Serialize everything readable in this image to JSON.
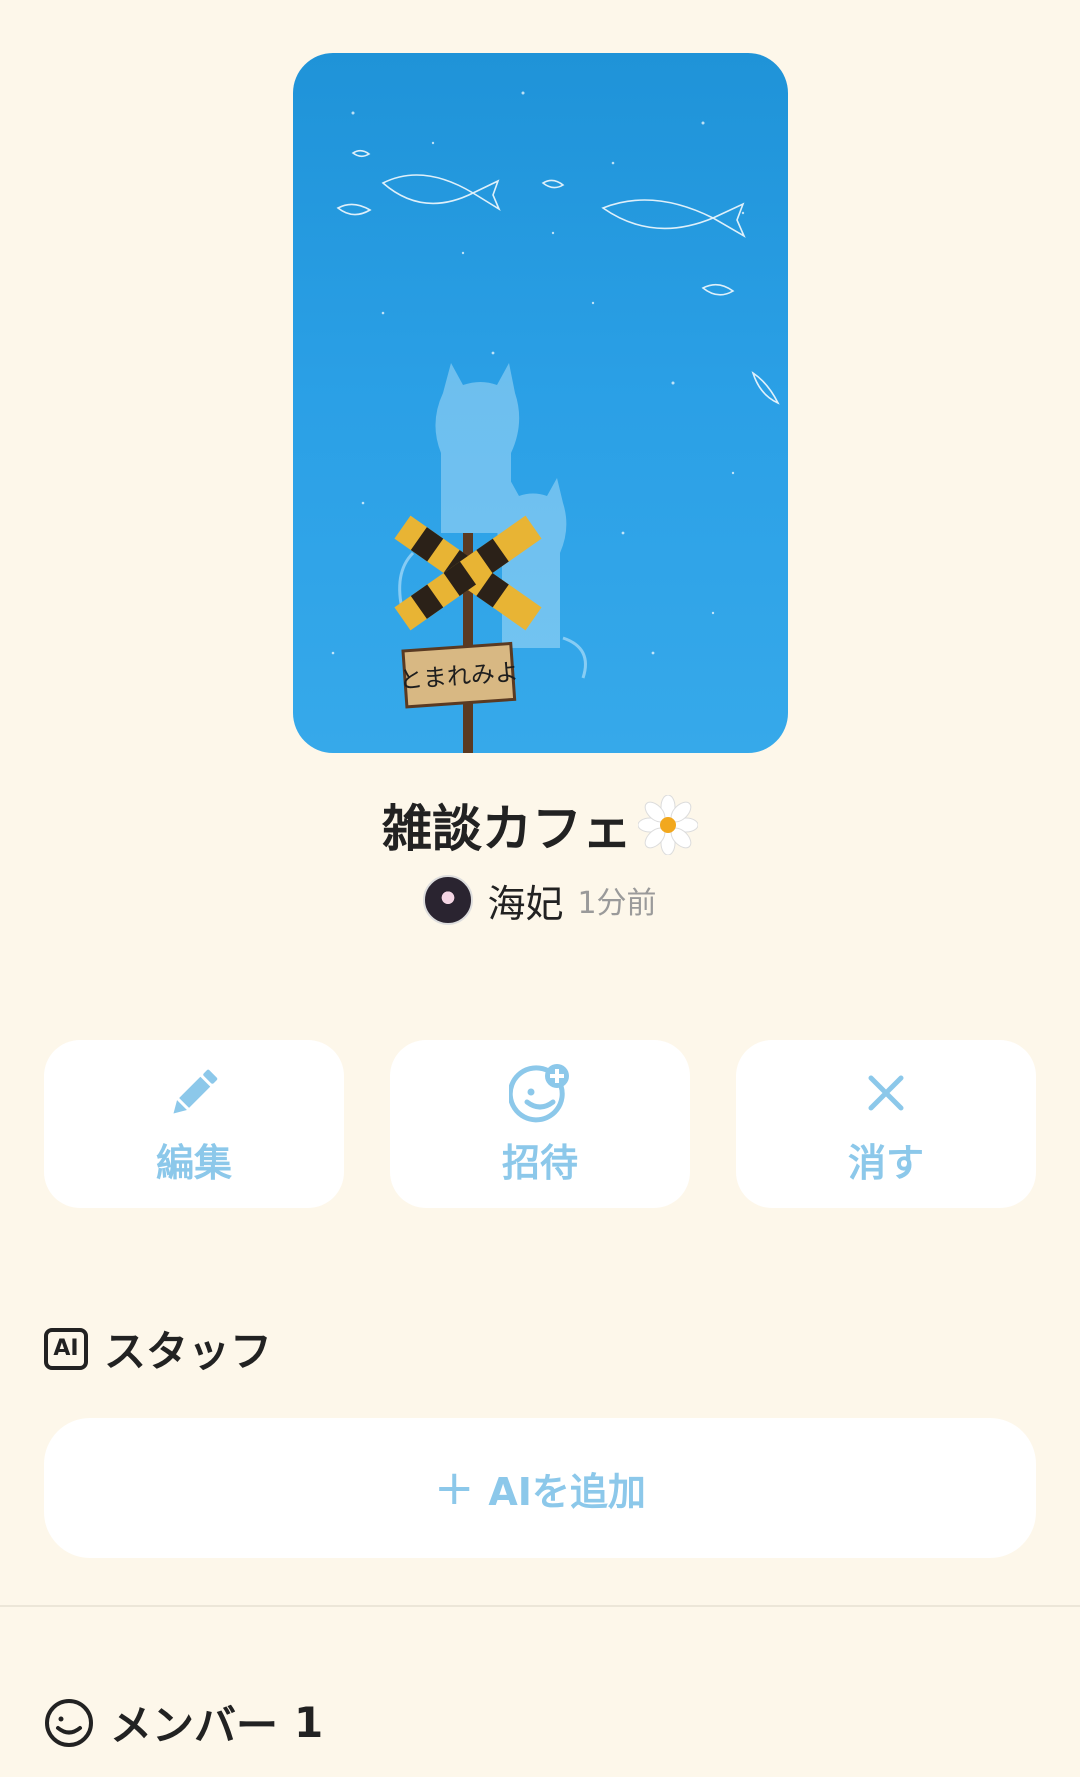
{
  "room": {
    "title": "雑談カフェ",
    "cover_sign_text": "とまれみよ",
    "author": {
      "name": "海妃",
      "time": "1分前"
    }
  },
  "actions": {
    "edit_label": "編集",
    "invite_label": "招待",
    "delete_label": "消す"
  },
  "staff": {
    "heading": "スタッフ",
    "ai_badge": "AI",
    "add_label": "AIを追加",
    "add_icon": "+"
  },
  "members": {
    "heading": "メンバー",
    "count": "1"
  },
  "colors": {
    "background": "#fdf7ea",
    "accent": "#8cc8ea",
    "card": "#ffffff"
  }
}
